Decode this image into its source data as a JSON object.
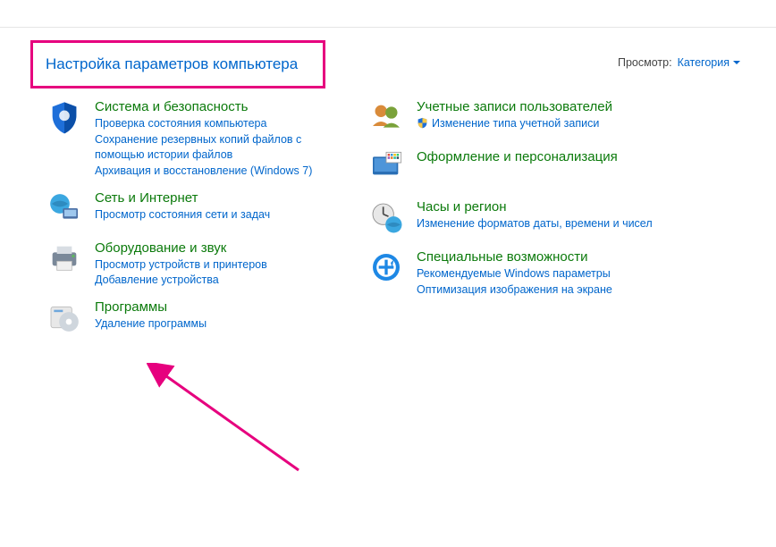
{
  "title": "Настройка параметров компьютера",
  "view_label": "Просмотр:",
  "view_value": "Категория",
  "left": [
    {
      "title": "Система и безопасность",
      "links": [
        {
          "text": "Проверка состояния компьютера"
        },
        {
          "text": "Сохранение резервных копий файлов с помощью истории файлов"
        },
        {
          "text": "Архивация и восстановление (Windows 7)"
        }
      ]
    },
    {
      "title": "Сеть и Интернет",
      "links": [
        {
          "text": "Просмотр состояния сети и задач"
        }
      ]
    },
    {
      "title": "Оборудование и звук",
      "links": [
        {
          "text": "Просмотр устройств и принтеров"
        },
        {
          "text": "Добавление устройства"
        }
      ]
    },
    {
      "title": "Программы",
      "links": [
        {
          "text": "Удаление программы"
        }
      ]
    }
  ],
  "right": [
    {
      "title": "Учетные записи пользователей",
      "links": [
        {
          "text": "Изменение типа учетной записи",
          "shield": true
        }
      ]
    },
    {
      "title": "Оформление и персонализация",
      "links": []
    },
    {
      "title": "Часы и регион",
      "links": [
        {
          "text": "Изменение форматов даты, времени и чисел"
        }
      ]
    },
    {
      "title": "Специальные возможности",
      "links": [
        {
          "text": "Рекомендуемые Windows параметры"
        },
        {
          "text": "Оптимизация изображения на экране"
        }
      ]
    }
  ]
}
